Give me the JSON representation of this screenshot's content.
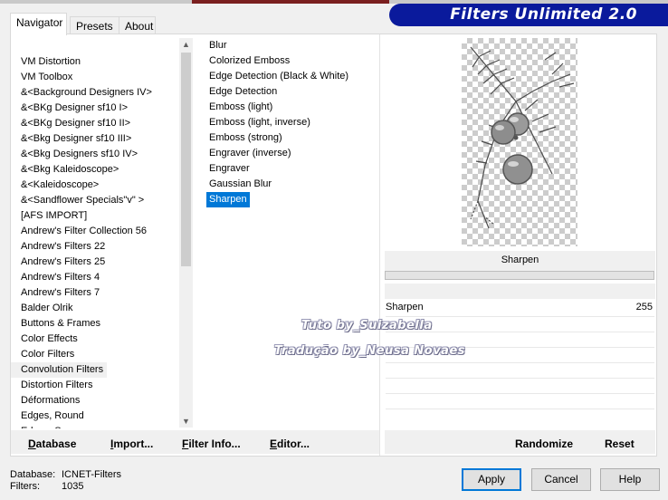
{
  "tabs": [
    {
      "label": "Navigator"
    },
    {
      "label": "Presets"
    },
    {
      "label": "About"
    }
  ],
  "banner_title": "Filters Unlimited 2.0",
  "categories": [
    "VM Distortion",
    "VM Toolbox",
    "&<Background Designers IV>",
    "&<BKg Designer sf10 I>",
    "&<BKg Designer sf10 II>",
    "&<Bkg Designer sf10 III>",
    "&<Bkg Designers sf10 IV>",
    "&<Bkg Kaleidoscope>",
    "&<Kaleidoscope>",
    "&<Sandflower Specials\"v\" >",
    "[AFS IMPORT]",
    "Andrew's Filter Collection 56",
    "Andrew's Filters 22",
    "Andrew's Filters 25",
    "Andrew's Filters 4",
    "Andrew's Filters 7",
    "Balder Olrik",
    "Buttons & Frames",
    "Color Effects",
    "Color Filters",
    "Convolution Filters",
    "Distortion Filters",
    "Déformations",
    "Edges, Round",
    "Edges, Square"
  ],
  "selected_category": "Convolution Filters",
  "filters": [
    "Blur",
    "Colorized Emboss",
    "Edge Detection (Black & White)",
    "Edge Detection",
    "Emboss (light)",
    "Emboss (light, inverse)",
    "Emboss (strong)",
    "Engraver (inverse)",
    "Engraver",
    "Gaussian Blur",
    "Sharpen"
  ],
  "selected_filter": "Sharpen",
  "preview": {
    "filter_name": "Sharpen"
  },
  "params": [
    {
      "label": "Sharpen",
      "value": "255"
    }
  ],
  "watermark": {
    "line1": "Tuto by_Suizabella",
    "line2": "Tradução by_Neusa Novaes"
  },
  "left_buttons": [
    {
      "u": "D",
      "rest": "atabase"
    },
    {
      "u": "I",
      "rest": "mport..."
    },
    {
      "u": "F",
      "rest": "ilter Info..."
    },
    {
      "u": "E",
      "rest": "ditor..."
    }
  ],
  "right_buttons": {
    "randomize": "Randomize",
    "reset": "Reset"
  },
  "status": {
    "database_label": "Database:",
    "database_value": "ICNET-Filters",
    "filters_label": "Filters:",
    "filters_value": "1035"
  },
  "dialog_buttons": {
    "apply": "Apply",
    "cancel": "Cancel",
    "help": "Help"
  },
  "colors": {
    "selection": "#0078d7",
    "banner": "#0a1a9c"
  }
}
